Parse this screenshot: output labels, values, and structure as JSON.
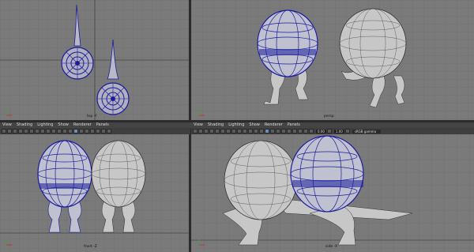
{
  "viewports": {
    "top_left": {
      "label": "top -Y"
    },
    "top_right": {
      "label": "persp"
    },
    "bottom_left": {
      "label": "front -Z"
    },
    "bottom_right": {
      "label": "side -X"
    }
  },
  "panel_menu": [
    "View",
    "Shading",
    "Lighting",
    "Show",
    "Renderer",
    "Panels"
  ],
  "toolbar_right": {
    "exposure": "0.00",
    "gamma": "1.00",
    "color_space": "sRGB gamma"
  },
  "colors": {
    "viewport_bg": "#7a7a7a",
    "wire_selected": "#1c1c9a",
    "mesh_fill": "#c7c7c7"
  }
}
